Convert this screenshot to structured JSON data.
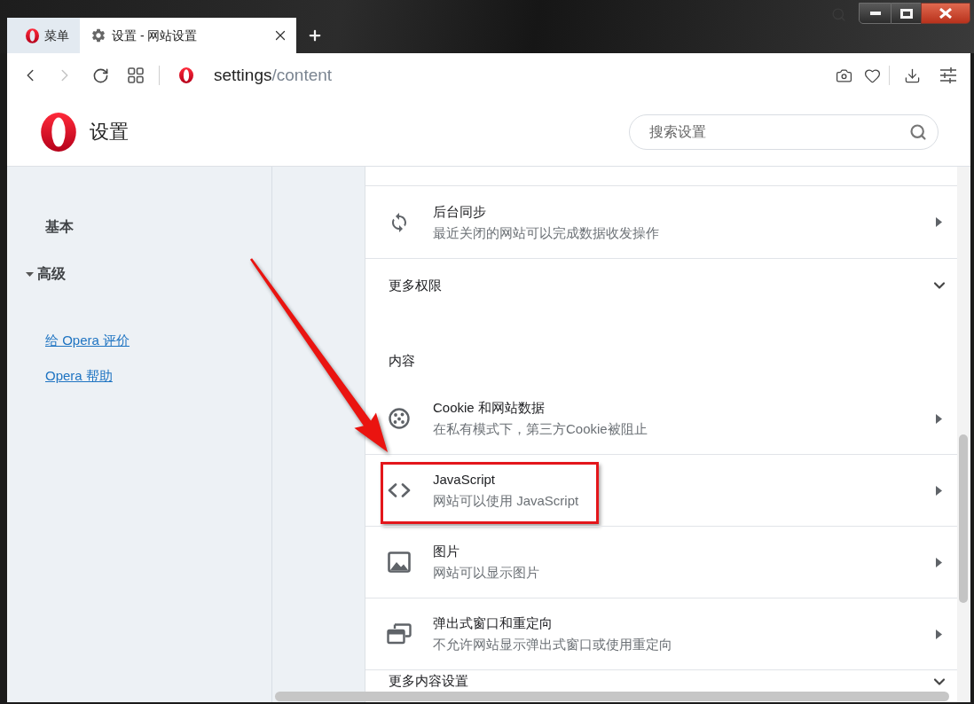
{
  "window": {
    "menu_button": {
      "label": "菜单"
    },
    "tabs": [
      {
        "label": "设置 - 网站设置",
        "selected": true
      }
    ]
  },
  "toolbar": {
    "back_enabled": true,
    "forward_enabled": false,
    "address": {
      "host": "settings",
      "path": "/content"
    }
  },
  "header": {
    "title": "设置",
    "search": {
      "placeholder": "搜索设置"
    }
  },
  "sidebar": {
    "items": [
      {
        "label": "基本",
        "kind": "page"
      },
      {
        "label": "高级",
        "kind": "group",
        "expanded": true
      }
    ],
    "links": [
      {
        "label": "给 Opera 评价"
      },
      {
        "label": "Opera 帮助"
      }
    ]
  },
  "permissions": {
    "rows": [
      {
        "kind": "sync",
        "title": "后台同步",
        "description": "最近关闭的网站可以完成数据收发操作"
      }
    ],
    "more": {
      "label": "更多权限",
      "expanded": false
    }
  },
  "content_section": {
    "heading": "内容",
    "rows": [
      {
        "kind": "cookie",
        "title": "Cookie 和网站数据",
        "description": "在私有模式下，第三方Cookie被阻止",
        "highlighted": false
      },
      {
        "kind": "code",
        "title": "JavaScript",
        "description": "网站可以使用 JavaScript",
        "highlighted": true
      },
      {
        "kind": "image",
        "title": "图片",
        "description": "网站可以显示图片",
        "highlighted": false
      },
      {
        "kind": "popup",
        "title": "弹出式窗口和重定向",
        "description": "不允许网站显示弹出式窗口或使用重定向",
        "highlighted": false
      }
    ],
    "more": {
      "label": "更多内容设置",
      "expanded": false
    }
  }
}
